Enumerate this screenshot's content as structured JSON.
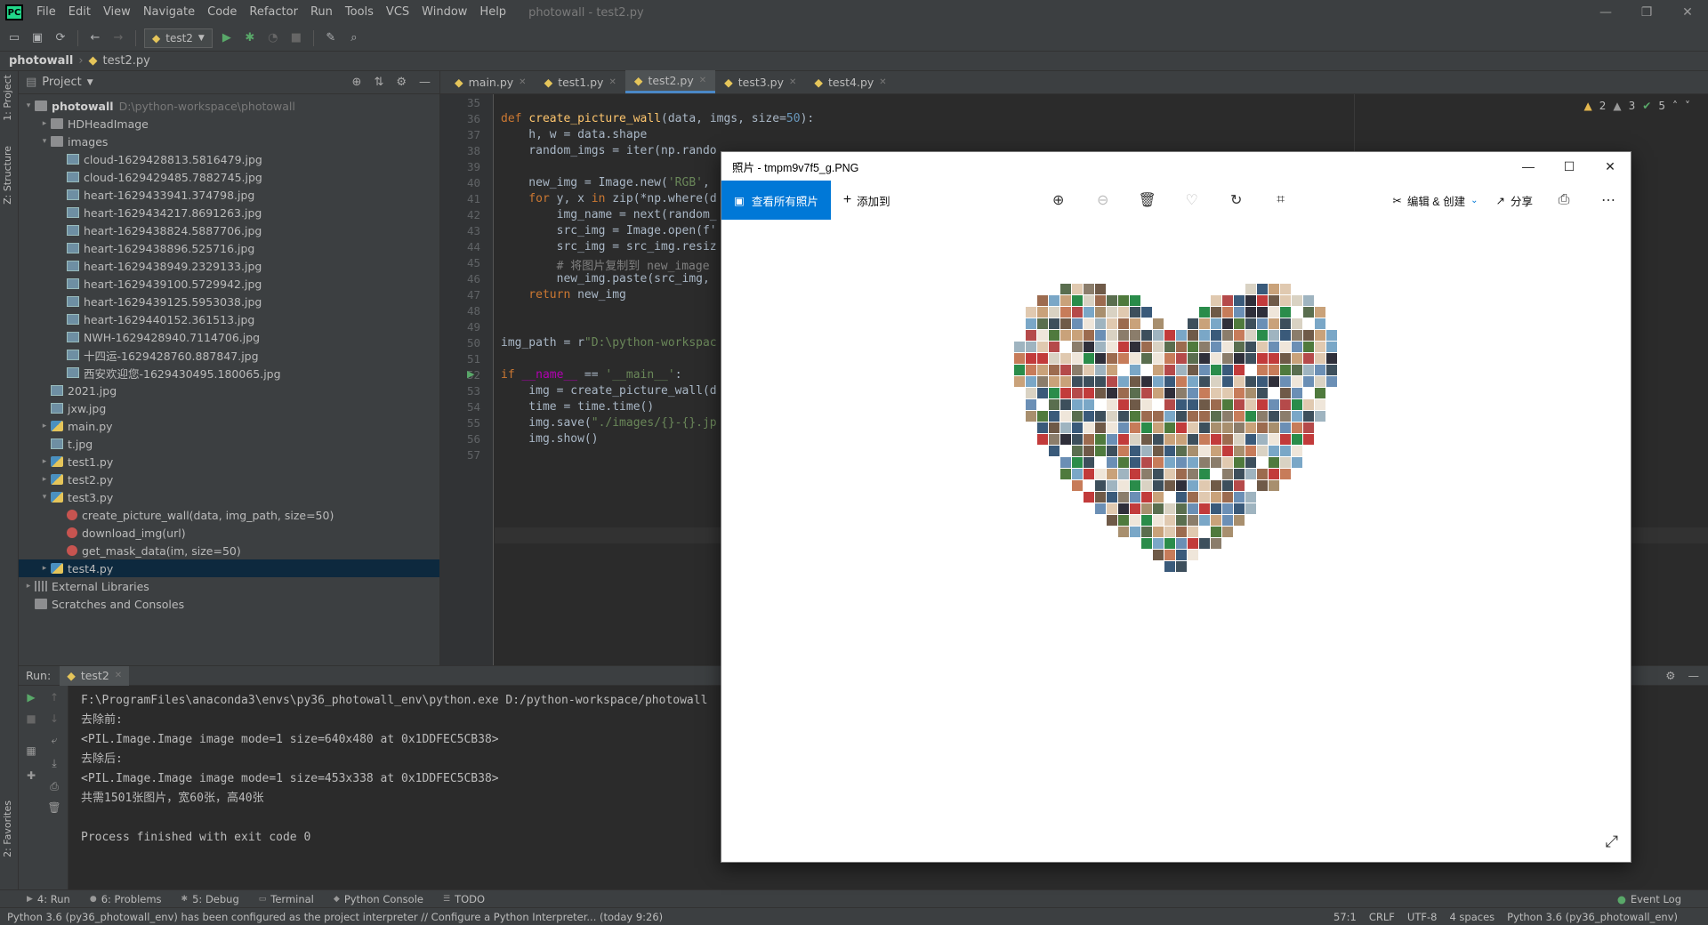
{
  "menubar": {
    "logo": "PC",
    "items": [
      "File",
      "Edit",
      "View",
      "Navigate",
      "Code",
      "Refactor",
      "Run",
      "Tools",
      "VCS",
      "Window",
      "Help"
    ],
    "title": "photowall - test2.py"
  },
  "toolbar": {
    "run_config": "test2"
  },
  "breadcrumb": {
    "project": "photowall",
    "file": "test2.py"
  },
  "leftstrip": {
    "project_tab": "1: Project",
    "structure_tab": "Z: Structure",
    "favorites_tab": "2: Favorites"
  },
  "project": {
    "title": "Project",
    "tree": [
      {
        "level": 0,
        "arrow": "▾",
        "icon": "folder",
        "label": "photowall",
        "path": "D:\\python-workspace\\photowall",
        "bold": true
      },
      {
        "level": 1,
        "arrow": "▸",
        "icon": "folder",
        "label": "HDHeadImage"
      },
      {
        "level": 1,
        "arrow": "▾",
        "icon": "folder",
        "label": "images"
      },
      {
        "level": 2,
        "arrow": "",
        "icon": "img",
        "label": "cloud-1629428813.5816479.jpg"
      },
      {
        "level": 2,
        "arrow": "",
        "icon": "img",
        "label": "cloud-1629429485.7882745.jpg"
      },
      {
        "level": 2,
        "arrow": "",
        "icon": "img",
        "label": "heart-1629433941.374798.jpg"
      },
      {
        "level": 2,
        "arrow": "",
        "icon": "img",
        "label": "heart-1629434217.8691263.jpg"
      },
      {
        "level": 2,
        "arrow": "",
        "icon": "img",
        "label": "heart-1629438824.5887706.jpg"
      },
      {
        "level": 2,
        "arrow": "",
        "icon": "img",
        "label": "heart-1629438896.525716.jpg"
      },
      {
        "level": 2,
        "arrow": "",
        "icon": "img",
        "label": "heart-1629438949.2329133.jpg"
      },
      {
        "level": 2,
        "arrow": "",
        "icon": "img",
        "label": "heart-1629439100.5729942.jpg"
      },
      {
        "level": 2,
        "arrow": "",
        "icon": "img",
        "label": "heart-1629439125.5953038.jpg"
      },
      {
        "level": 2,
        "arrow": "",
        "icon": "img",
        "label": "heart-1629440152.361513.jpg"
      },
      {
        "level": 2,
        "arrow": "",
        "icon": "img",
        "label": "NWH-1629428940.7114706.jpg"
      },
      {
        "level": 2,
        "arrow": "",
        "icon": "img",
        "label": "十四运-1629428760.887847.jpg"
      },
      {
        "level": 2,
        "arrow": "",
        "icon": "img",
        "label": "西安欢迎您-1629430495.180065.jpg"
      },
      {
        "level": 1,
        "arrow": "",
        "icon": "img",
        "label": "2021.jpg"
      },
      {
        "level": 1,
        "arrow": "",
        "icon": "img",
        "label": "jxw.jpg"
      },
      {
        "level": 1,
        "arrow": "▸",
        "icon": "py",
        "label": "main.py"
      },
      {
        "level": 1,
        "arrow": "",
        "icon": "img",
        "label": "t.jpg"
      },
      {
        "level": 1,
        "arrow": "▸",
        "icon": "py",
        "label": "test1.py"
      },
      {
        "level": 1,
        "arrow": "▸",
        "icon": "py",
        "label": "test2.py"
      },
      {
        "level": 1,
        "arrow": "▾",
        "icon": "py",
        "label": "test3.py"
      },
      {
        "level": 2,
        "arrow": "",
        "icon": "fn",
        "label": "create_picture_wall(data, img_path, size=50)"
      },
      {
        "level": 2,
        "arrow": "",
        "icon": "fn",
        "label": "download_img(url)"
      },
      {
        "level": 2,
        "arrow": "",
        "icon": "fn",
        "label": "get_mask_data(im, size=50)"
      },
      {
        "level": 1,
        "arrow": "▸",
        "icon": "py",
        "label": "test4.py",
        "selected": true
      },
      {
        "level": 0,
        "arrow": "▸",
        "icon": "lib",
        "label": "External Libraries"
      },
      {
        "level": 0,
        "arrow": "",
        "icon": "folder",
        "label": "Scratches and Consoles"
      }
    ]
  },
  "editor_tabs": [
    {
      "label": "main.py",
      "active": false
    },
    {
      "label": "test1.py",
      "active": false
    },
    {
      "label": "test2.py",
      "active": true
    },
    {
      "label": "test3.py",
      "active": false
    },
    {
      "label": "test4.py",
      "active": false
    }
  ],
  "inspections": {
    "warnings1": "2",
    "warnings2": "3",
    "ok": "5"
  },
  "code": {
    "line_numbers": [
      "35",
      "36",
      "37",
      "38",
      "39",
      "40",
      "41",
      "42",
      "43",
      "44",
      "45",
      "46",
      "47",
      "48",
      "49",
      "50",
      "51",
      "52",
      "53",
      "54",
      "55",
      "56",
      "57"
    ],
    "lines": [
      [],
      [
        [
          "kw",
          "def "
        ],
        [
          "fnm",
          "create_picture_wall"
        ],
        [
          "",
          "(data, imgs, size="
        ],
        [
          "num",
          "50"
        ],
        [
          "",
          "):"
        ]
      ],
      [
        [
          "",
          "    h, w = data.shape"
        ]
      ],
      [
        [
          "",
          "    random_imgs = iter(np.rando"
        ]
      ],
      [],
      [
        [
          "",
          "    new_img = Image.new("
        ],
        [
          "str",
          "'RGB'"
        ],
        [
          "",
          ","
        ]
      ],
      [
        [
          "kw",
          "    for "
        ],
        [
          "",
          "y, x "
        ],
        [
          "kw",
          "in "
        ],
        [
          "",
          "zip(*np.where(d"
        ]
      ],
      [
        [
          "",
          "        img_name = next(random_"
        ]
      ],
      [
        [
          "",
          "        src_img = Image.open(f'"
        ]
      ],
      [
        [
          "",
          "        src_img = src_img.resiz"
        ]
      ],
      [
        [
          "cm",
          "        # 将图片复制到 new_image"
        ]
      ],
      [
        [
          "",
          "        new_img.paste(src_img,"
        ]
      ],
      [
        [
          "kw",
          "    return "
        ],
        [
          "",
          "new_img"
        ]
      ],
      [],
      [],
      [
        [
          "",
          "img_path = r"
        ],
        [
          "str",
          "\"D:\\python-workspac"
        ]
      ],
      [],
      [
        [
          "kw",
          "if "
        ],
        [
          "mg",
          "__name__"
        ],
        [
          "",
          " == "
        ],
        [
          "str",
          "'__main__'"
        ],
        [
          "",
          ":"
        ]
      ],
      [
        [
          "",
          "    img = create_picture_wall(d"
        ]
      ],
      [
        [
          "",
          "    time = time.time()"
        ]
      ],
      [
        [
          "",
          "    img.save("
        ],
        [
          "str",
          "\"./images/{}-{}.jp"
        ]
      ],
      [
        [
          "",
          "    img.show()"
        ]
      ],
      []
    ]
  },
  "run": {
    "label": "Run:",
    "tab": "test2",
    "output": [
      "F:\\ProgramFiles\\anaconda3\\envs\\py36_photowall_env\\python.exe D:/python-workspace/photowall",
      "去除前:",
      "<PIL.Image.Image image mode=1 size=640x480 at 0x1DDFEC5CB38>",
      "去除后:",
      "<PIL.Image.Image image mode=1 size=453x338 at 0x1DDFEC5CB38>",
      "共需1501张图片，宽60张，高40张",
      "",
      "Process finished with exit code 0"
    ]
  },
  "bottom_tabs": [
    {
      "label": "4: Run"
    },
    {
      "label": "6: Problems"
    },
    {
      "label": "5: Debug"
    },
    {
      "label": "Terminal"
    },
    {
      "label": "Python Console"
    },
    {
      "label": "TODO"
    }
  ],
  "event_log": "Event Log",
  "status": {
    "message": "Python 3.6 (py36_photowall_env) has been configured as the project interpreter // Configure a Python Interpreter... (today 9:26)",
    "position": "57:1",
    "line_sep": "CRLF",
    "encoding": "UTF-8",
    "indent": "4 spaces",
    "interpreter": "Python 3.6 (py36_photowall_env)"
  },
  "photos": {
    "title": "照片 - tmpm9v7f5_g.PNG",
    "view_all": "查看所有照片",
    "add_to": "添加到",
    "edit_create": "编辑 & 创建",
    "share": "分享"
  },
  "colors": {
    "accent": "#0078d7",
    "ide_bg": "#2b2b2b",
    "panel_bg": "#3c3f41"
  }
}
